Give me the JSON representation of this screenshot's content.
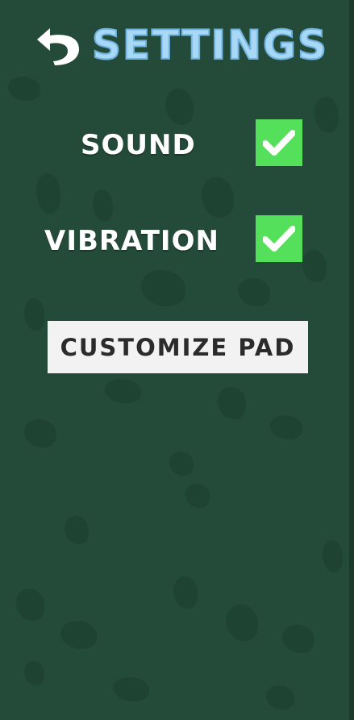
{
  "header": {
    "title": "SETTINGS",
    "back_icon": "back-arrow-icon"
  },
  "settings": {
    "sound": {
      "label": "SOUND",
      "checked": true
    },
    "vibration": {
      "label": "VIBRATION",
      "checked": true
    }
  },
  "customize_button": {
    "label": "CUSTOMIZE PAD"
  },
  "colors": {
    "background": "#244b3a",
    "pattern": "#1f4232",
    "title": "#a8d8f5",
    "checkbox": "#54e05a",
    "button": "#f2f2f2",
    "button_text": "#2b2b2b"
  }
}
